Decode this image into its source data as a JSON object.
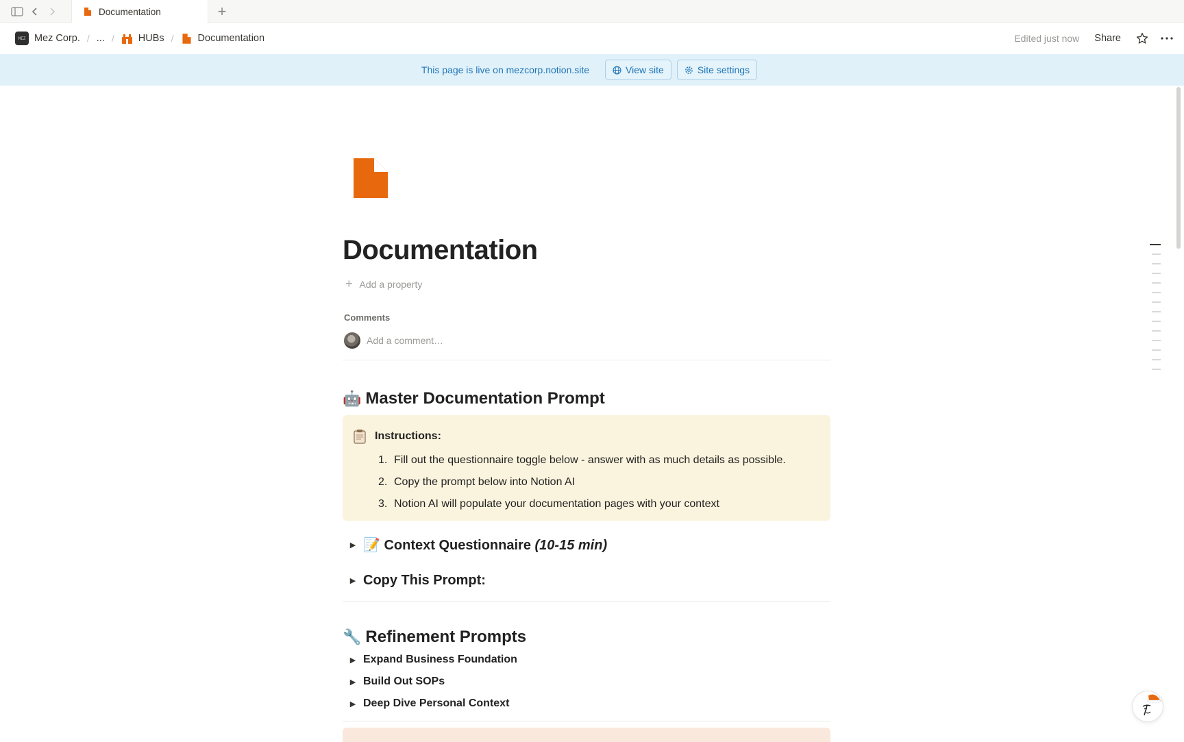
{
  "tabs": [
    {
      "label": "Documentation",
      "icon": "page-icon"
    }
  ],
  "breadcrumb": {
    "workspace": "Mez Corp.",
    "workspace_logo": "MEZ",
    "ellipsis": "...",
    "hubs": "HUBs",
    "current": "Documentation"
  },
  "header": {
    "edited": "Edited just now",
    "share": "Share"
  },
  "banner": {
    "text": "This page is live on mezcorp.notion.site",
    "view_site": "View site",
    "site_settings": "Site settings"
  },
  "page": {
    "title": "Documentation",
    "add_property": "Add a property",
    "comments_label": "Comments",
    "comment_placeholder": "Add a comment…",
    "sections": {
      "master": {
        "emoji": "🤖",
        "heading": "Master Documentation Prompt"
      },
      "refinement": {
        "emoji": "🔧",
        "heading": "Refinement Prompts"
      }
    },
    "callout": {
      "title": "Instructions:",
      "items": [
        {
          "num": "1.",
          "text": "Fill out the questionnaire toggle below - answer with as much details as possible."
        },
        {
          "num": "2.",
          "text": "Copy the prompt below into Notion AI"
        },
        {
          "num": "3.",
          "text": "Notion AI will populate your documentation pages with your context"
        }
      ]
    },
    "toggles": {
      "questionnaire": {
        "emoji": "📝",
        "label": "Context Questionnaire",
        "label_em": "(10-15 min)"
      },
      "copy_prompt": {
        "label": "Copy This Prompt:"
      },
      "refinement_items": [
        "Expand Business Foundation",
        "Build Out SOPs",
        "Deep Dive Personal Context"
      ]
    }
  },
  "colors": {
    "accent_orange": "#e8690d",
    "banner_bg": "#e1f1f9",
    "banner_text": "#1f76b9",
    "callout_bg": "#faf3dd"
  }
}
